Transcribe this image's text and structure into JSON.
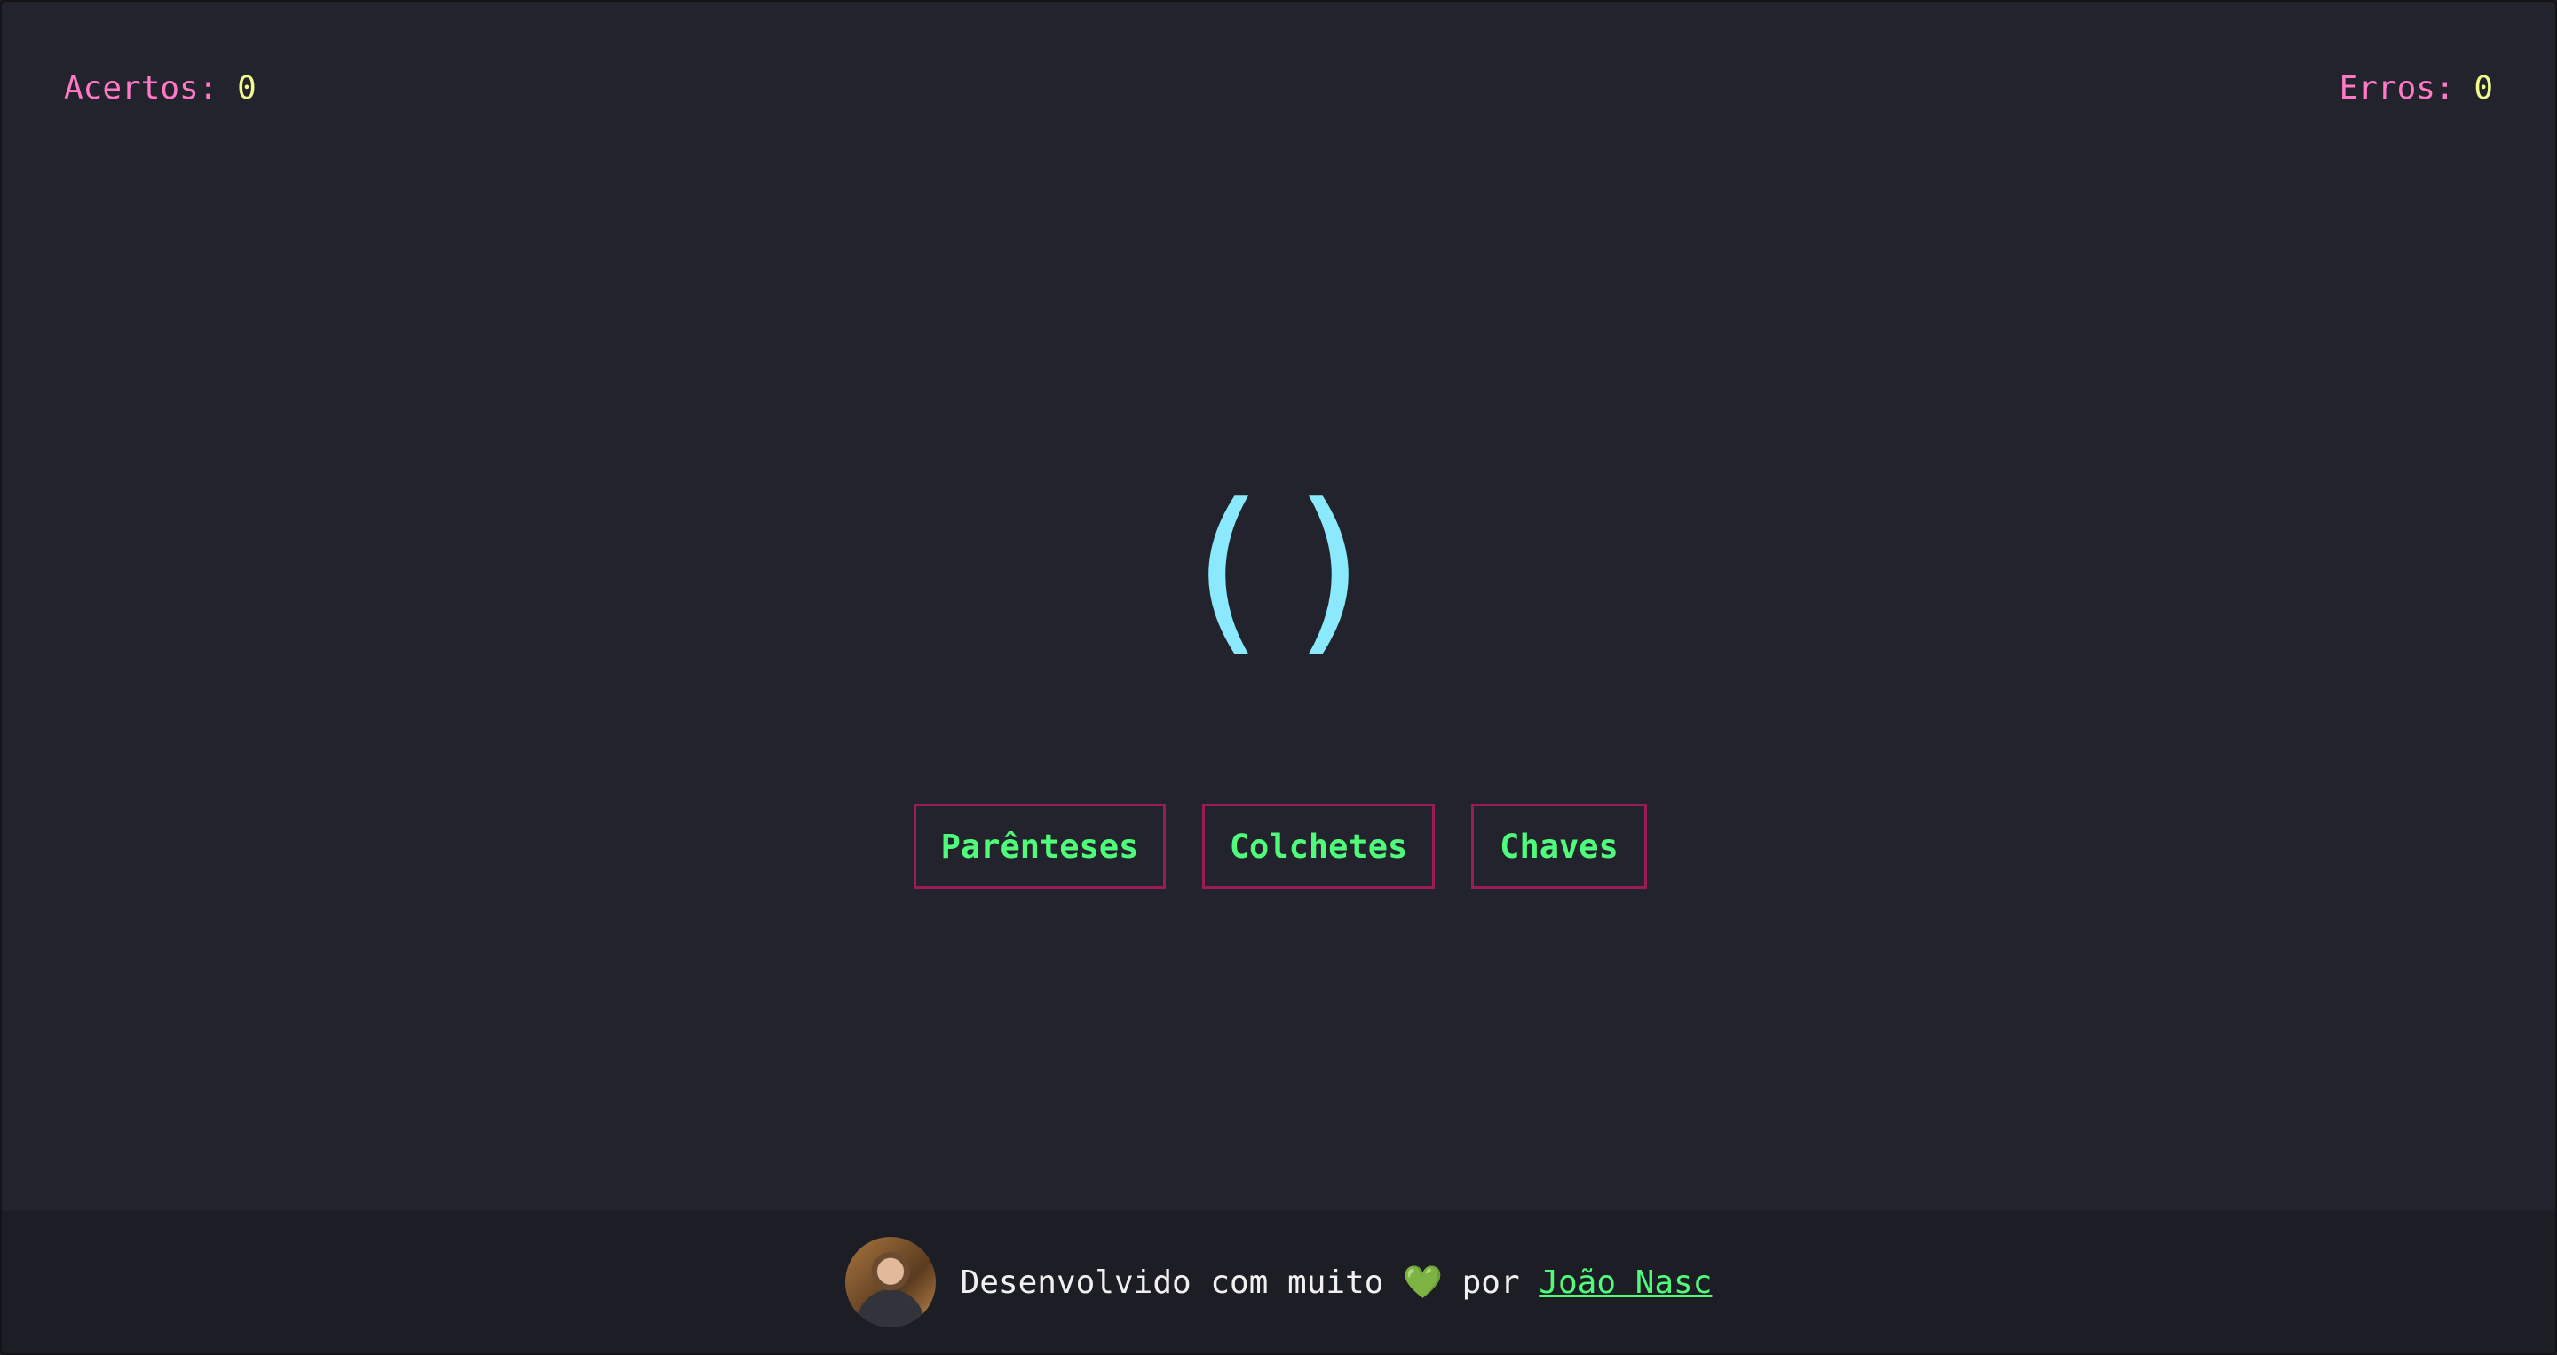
{
  "score": {
    "hits_label": "Acertos:",
    "hits_value": "0",
    "errors_label": "Erros:",
    "errors_value": "0"
  },
  "symbol": {
    "open": "(",
    "close": ")"
  },
  "options": [
    {
      "label": "Parênteses"
    },
    {
      "label": "Colchetes"
    },
    {
      "label": "Chaves"
    }
  ],
  "footer": {
    "prefix": "Desenvolvido com muito",
    "heart": "💚",
    "by": "por",
    "author": "João Nasc"
  },
  "colors": {
    "background": "#22232c",
    "score_label": "#ff79c6",
    "score_value": "#f1fa8c",
    "symbol": "#8be9fd",
    "button_text": "#50fa7b",
    "button_border": "#9a1b56",
    "link": "#50fa7b"
  },
  "icons": {
    "avatar": "author-avatar-photo",
    "heart": "green-heart-icon"
  }
}
